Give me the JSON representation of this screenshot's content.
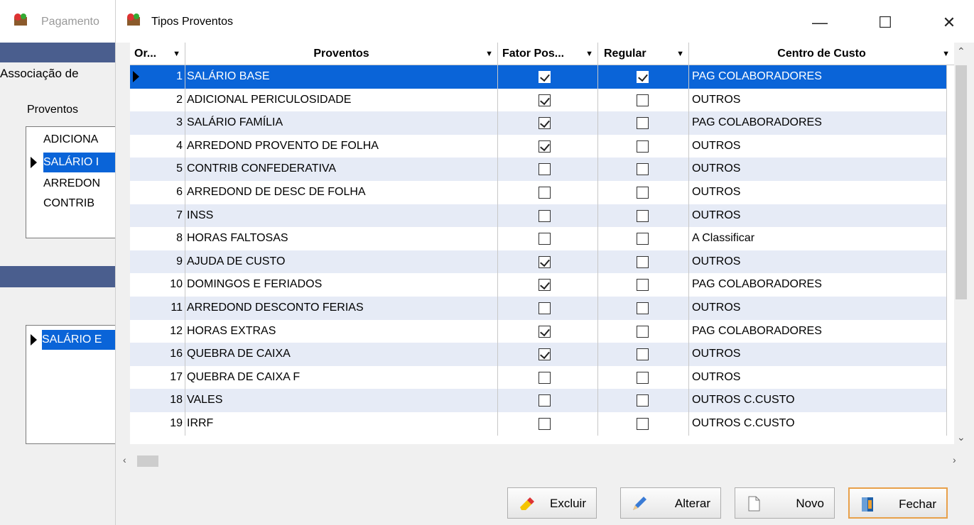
{
  "background_window": {
    "title": "Pagamento",
    "section_label": "Associação de",
    "proventos_label": "Proventos",
    "list_items": [
      "ADICIONA",
      "SALÁRIO I",
      "ARREDON",
      "CONTRIB"
    ],
    "selected_item": "SALÁRIO E"
  },
  "window": {
    "title": "Tipos Proventos",
    "minimize_glyph": "—",
    "maximize_glyph": "☐",
    "close_glyph": "✕"
  },
  "grid": {
    "columns": [
      "Or...",
      "Proventos",
      "Fator Pos...",
      "Regular",
      "Centro de Custo"
    ],
    "rows": [
      {
        "ord": "1",
        "provento": "SALÁRIO BASE",
        "fator": true,
        "regular": true,
        "centro": "PAG COLABORADORES",
        "selected": true
      },
      {
        "ord": "2",
        "provento": "ADICIONAL PERICULOSIDADE",
        "fator": true,
        "regular": false,
        "centro": "OUTROS"
      },
      {
        "ord": "3",
        "provento": "SALÁRIO FAMÍLIA",
        "fator": true,
        "regular": false,
        "centro": "PAG COLABORADORES"
      },
      {
        "ord": "4",
        "provento": "ARREDOND PROVENTO DE FOLHA",
        "fator": true,
        "regular": false,
        "centro": "OUTROS"
      },
      {
        "ord": "5",
        "provento": "CONTRIB CONFEDERATIVA",
        "fator": false,
        "regular": false,
        "centro": "OUTROS"
      },
      {
        "ord": "6",
        "provento": "ARREDOND DE DESC DE FOLHA",
        "fator": false,
        "regular": false,
        "centro": "OUTROS"
      },
      {
        "ord": "7",
        "provento": "INSS",
        "fator": false,
        "regular": false,
        "centro": "OUTROS"
      },
      {
        "ord": "8",
        "provento": "HORAS FALTOSAS",
        "fator": false,
        "regular": false,
        "centro": "A Classificar"
      },
      {
        "ord": "9",
        "provento": "AJUDA DE CUSTO",
        "fator": true,
        "regular": false,
        "centro": "OUTROS"
      },
      {
        "ord": "10",
        "provento": "DOMINGOS E FERIADOS",
        "fator": true,
        "regular": false,
        "centro": "PAG COLABORADORES"
      },
      {
        "ord": "11",
        "provento": "ARREDOND DESCONTO FERIAS",
        "fator": false,
        "regular": false,
        "centro": "OUTROS"
      },
      {
        "ord": "12",
        "provento": "HORAS EXTRAS",
        "fator": true,
        "regular": false,
        "centro": "PAG COLABORADORES"
      },
      {
        "ord": "16",
        "provento": "QUEBRA DE CAIXA",
        "fator": true,
        "regular": false,
        "centro": "OUTROS"
      },
      {
        "ord": "17",
        "provento": "QUEBRA DE CAIXA F",
        "fator": false,
        "regular": false,
        "centro": "OUTROS"
      },
      {
        "ord": "18",
        "provento": "VALES",
        "fator": false,
        "regular": false,
        "centro": "OUTROS  C.CUSTO"
      },
      {
        "ord": "19",
        "provento": "IRRF",
        "fator": false,
        "regular": false,
        "centro": "OUTROS  C.CUSTO"
      }
    ]
  },
  "buttons": {
    "excluir": "Excluir",
    "alterar": "Alterar",
    "novo": "Novo",
    "fechar": "Fechar"
  },
  "icons": [
    "app-icon",
    "eraser-icon",
    "pencil-icon",
    "new-document-icon",
    "exit-door-icon",
    "sort-arrow-icon",
    "row-pointer-icon"
  ],
  "colors": {
    "selection": "#0a64d8",
    "alt_row": "#e6ebf6",
    "band": "#4a5e8e"
  }
}
